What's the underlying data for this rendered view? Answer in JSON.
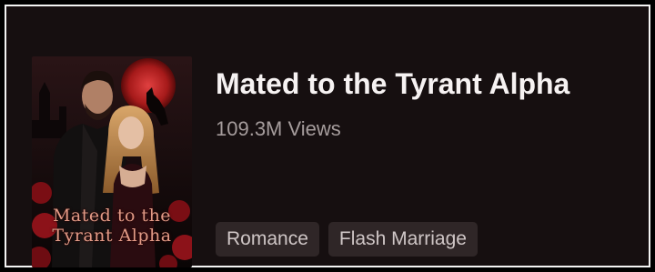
{
  "book": {
    "title": "Mated to the Tyrant Alpha",
    "views": "109.3M Views",
    "cover": {
      "title_line1": "Mated to the",
      "title_line2": "Tyrant Alpha"
    },
    "tags": [
      {
        "label": "Romance"
      },
      {
        "label": "Flash Marriage"
      }
    ]
  },
  "colors": {
    "card_background": "#160f10",
    "title_text": "#f6f2f2",
    "views_text": "#a59c9c",
    "tag_background": "#2f2627",
    "cover_title": "#e29a86"
  }
}
